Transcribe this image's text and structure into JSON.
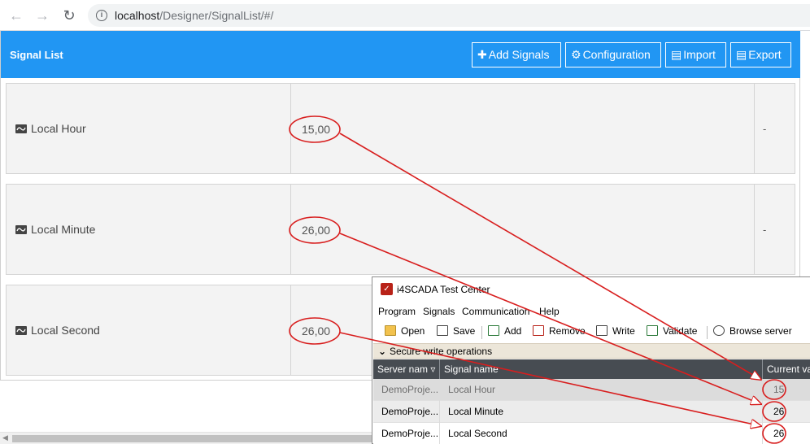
{
  "browser": {
    "url_host": "localhost",
    "url_path": "/Designer/SignalList/#/"
  },
  "app": {
    "title": "Signal List",
    "buttons": {
      "add": "Add Signals",
      "configuration": "Configuration",
      "import": "Import",
      "export": "Export"
    },
    "rows": [
      {
        "name": "Local Hour",
        "value": "15,00",
        "extra": "-"
      },
      {
        "name": "Local Minute",
        "value": "26,00",
        "extra": "-"
      },
      {
        "name": "Local Second",
        "value": "26,00",
        "extra": ""
      }
    ]
  },
  "test_center": {
    "title": "i4SCADA Test Center",
    "menu": [
      "Program",
      "Signals",
      "Communication",
      "Help"
    ],
    "toolbar": [
      "Open",
      "Save",
      "Add",
      "Remove",
      "Write",
      "Validate",
      "Browse server"
    ],
    "secure_label": "Secure write operations",
    "columns": [
      "Server nam",
      "Signal name",
      "Current val"
    ],
    "rows": [
      {
        "server": "DemoProje...",
        "signal": "Local Hour",
        "value": "15"
      },
      {
        "server": "DemoProje...",
        "signal": "Local Minute",
        "value": "26"
      },
      {
        "server": "DemoProje...",
        "signal": "Local Second",
        "value": "26"
      }
    ]
  },
  "colors": {
    "header_blue": "#2196f3",
    "annotation_red": "#d81e1e",
    "grid_header": "#474c52"
  }
}
